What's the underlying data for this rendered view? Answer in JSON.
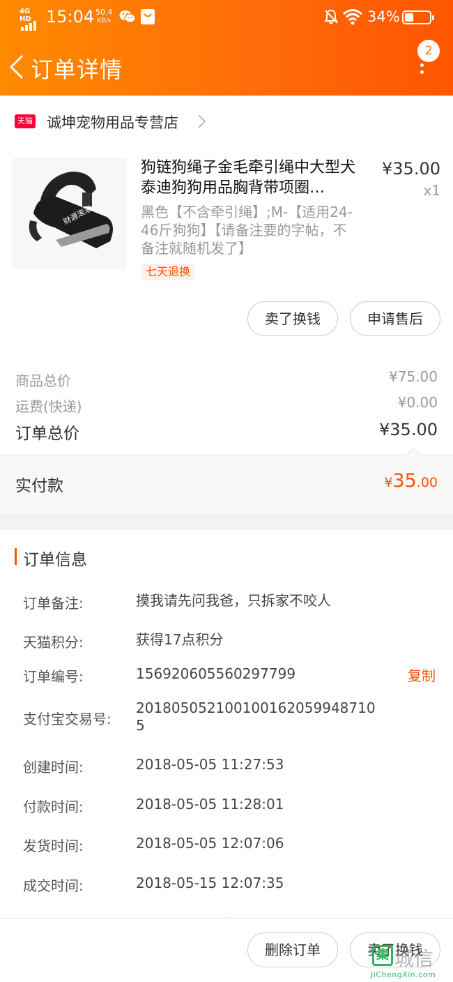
{
  "status_bar": {
    "network": "4G HD",
    "time": "15:04",
    "speed_value": "50.4",
    "speed_unit": "KB/s",
    "battery": "34%"
  },
  "nav": {
    "title": "订单详情",
    "message_count": "2"
  },
  "shop": {
    "logo_text": "天猫",
    "name": "诚坤宠物用品专营店"
  },
  "product": {
    "title": "狗链狗绳子金毛牵引绳中大型犬泰迪狗狗用品胸背带项圈…",
    "price": "¥35.00",
    "quantity": "x1",
    "sku": "黑色【不含牵引绳】;M-【适用24-46斤狗狗】【请备注要的字帖，不备注就随机发了】",
    "image_text": "财源滚滚",
    "tag": "七天退换",
    "actions": [
      "卖了换钱",
      "申请售后"
    ]
  },
  "fees": {
    "goods_total_label": "商品总价",
    "goods_total_value": "¥75.00",
    "shipping_label": "运费(快递)",
    "shipping_value": "¥0.00",
    "order_total_label": "订单总价",
    "order_total_value": "¥35.00",
    "paid_label": "实付款",
    "paid_currency": "¥",
    "paid_int": "35",
    "paid_dec": ".00"
  },
  "order_info": {
    "title": "订单信息",
    "copy_label": "复制",
    "rows": [
      {
        "label": "订单备注:",
        "value": "摸我请先问我爸，只拆家不咬人"
      },
      {
        "label": "天猫积分:",
        "value": "获得17点积分"
      },
      {
        "label": "订单编号:",
        "value": "156920605560297799"
      },
      {
        "label": "支付宝交易号:",
        "value": "2018050521001001620599487105"
      },
      {
        "label": "创建时间:",
        "value": "2018-05-05 11:27:53"
      },
      {
        "label": "付款时间:",
        "value": "2018-05-05 11:28:01"
      },
      {
        "label": "发货时间:",
        "value": "2018-05-05 12:07:06"
      },
      {
        "label": "成交时间:",
        "value": "2018-05-15 12:07:35"
      }
    ]
  },
  "bottom_actions": [
    "删除订单",
    "卖了换钱"
  ],
  "watermark": {
    "box": "集",
    "text": "城信",
    "url": "JiChengXin.com"
  },
  "colors": {
    "accent": "#ff5000",
    "header_start": "#ff8a00",
    "header_end": "#ff5500",
    "tmall_red": "#ff0036"
  }
}
